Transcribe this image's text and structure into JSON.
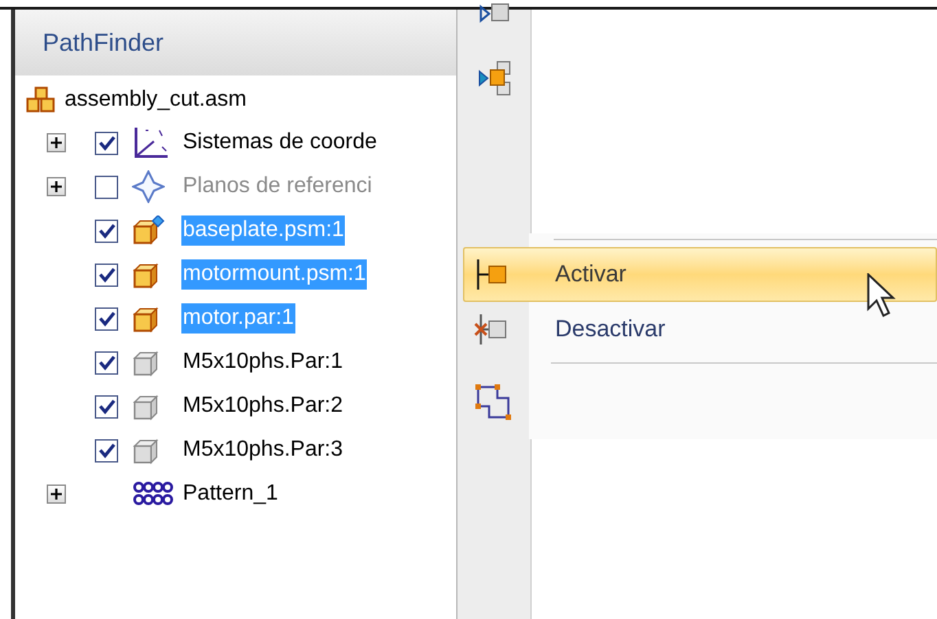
{
  "panel": {
    "title": "PathFinder"
  },
  "tree": {
    "root": {
      "label": "assembly_cut.asm"
    },
    "children": [
      {
        "label": "Sistemas de coorde",
        "kind": "coords",
        "expanded": false,
        "checked": true,
        "selected": false,
        "dimmed": false
      },
      {
        "label": "Planos de referenci",
        "kind": "planes",
        "expanded": false,
        "checked": false,
        "selected": false,
        "dimmed": true
      },
      {
        "label": "baseplate.psm:1",
        "kind": "sheetmetal",
        "checked": true,
        "selected": true,
        "dimmed": false
      },
      {
        "label": "motormount.psm:1",
        "kind": "part",
        "checked": true,
        "selected": true,
        "dimmed": false
      },
      {
        "label": "motor.par:1",
        "kind": "part",
        "checked": true,
        "selected": true,
        "dimmed": false
      },
      {
        "label": "M5x10phs.Par:1",
        "kind": "hardware",
        "checked": true,
        "selected": false,
        "dimmed": false
      },
      {
        "label": "M5x10phs.Par:2",
        "kind": "hardware",
        "checked": true,
        "selected": false,
        "dimmed": false
      },
      {
        "label": "M5x10phs.Par:3",
        "kind": "hardware",
        "checked": true,
        "selected": false,
        "dimmed": false
      },
      {
        "label": "Pattern_1",
        "kind": "pattern",
        "expanded": false,
        "selected": false,
        "dimmed": false
      }
    ]
  },
  "menu": {
    "items": [
      {
        "label": "Activar",
        "kind": "activate",
        "selected": true
      },
      {
        "label": "Desactivar",
        "kind": "deactivate",
        "selected": false
      },
      {
        "kind": "fit",
        "selected": false
      }
    ]
  }
}
